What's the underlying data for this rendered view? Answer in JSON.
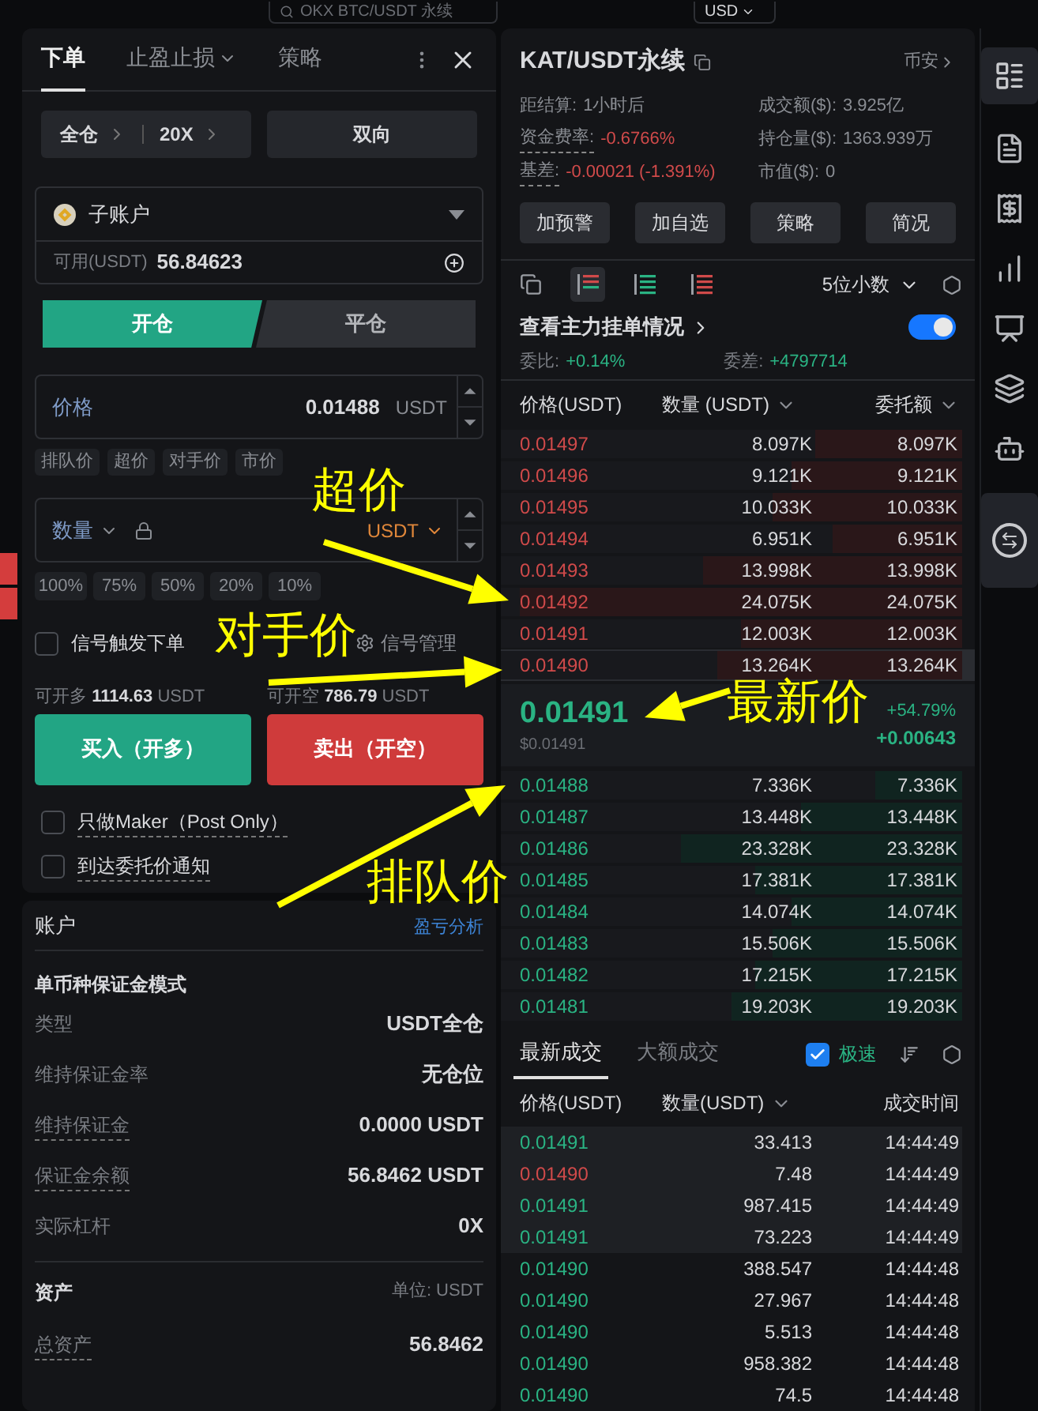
{
  "top_bar": {
    "search": "OKX BTC/USDT 永续",
    "currency": "USD"
  },
  "order_panel": {
    "tabs": [
      {
        "label": "下单",
        "selected": true,
        "dropdown": false
      },
      {
        "label": "止盈止损",
        "selected": false,
        "dropdown": true
      },
      {
        "label": "策略",
        "selected": false,
        "dropdown": false
      }
    ],
    "margin_mode": "全仓",
    "leverage": "20X",
    "position_mode": "双向",
    "account": {
      "name": "子账户",
      "available_label": "可用(USDT)",
      "available": "56.84623"
    },
    "sides": [
      {
        "label": "开仓",
        "selected": true
      },
      {
        "label": "平仓",
        "selected": false
      }
    ],
    "price": {
      "label": "价格",
      "value": "0.01488",
      "unit": "USDT"
    },
    "price_types": [
      "排队价",
      "超价",
      "对手价",
      "市价"
    ],
    "quantity": {
      "label": "数量",
      "unit": "USDT"
    },
    "percents": [
      "100%",
      "75%",
      "50%",
      "20%",
      "10%"
    ],
    "signal": {
      "label": "信号触发下单",
      "checked": false,
      "manage": "信号管理"
    },
    "max_long": {
      "label": "可开多",
      "value": "1114.63",
      "unit": "USDT"
    },
    "max_short": {
      "label": "可开空",
      "value": "786.79",
      "unit": "USDT"
    },
    "buy": "买入（开多）",
    "sell": "卖出（开空）",
    "options": [
      {
        "label": "只做Maker（Post Only）",
        "checked": false
      },
      {
        "label": "到达委托价通知",
        "checked": false
      }
    ]
  },
  "account_panel": {
    "title": "账户",
    "link": "盈亏分析",
    "mode": "单币种保证金模式",
    "rows": [
      {
        "label": "类型",
        "value": "USDT全仓",
        "dashed": false
      },
      {
        "label": "维持保证金率",
        "value": "无仓位",
        "dashed": false
      },
      {
        "label": "维持保证金",
        "value": "0.0000 USDT",
        "dashed": true
      },
      {
        "label": "保证金余额",
        "value": "56.8462 USDT",
        "dashed": true
      },
      {
        "label": "实际杠杆",
        "value": "0X",
        "dashed": false
      }
    ],
    "assets_title": "资产",
    "unit": "单位: USDT",
    "asset_rows": [
      {
        "label": "总资产",
        "value": "56.8462",
        "dashed": true
      }
    ]
  },
  "market": {
    "symbol": "KAT/USDT永续",
    "exchange": "币安",
    "stats": [
      {
        "label": "距结算:",
        "value": "1小时后",
        "kind": "plain",
        "dashed": false
      },
      {
        "label": "成交额($):",
        "value": "3.925亿",
        "kind": "plain",
        "dashed": false
      },
      {
        "label": "资金费率:",
        "value": "-0.6766%",
        "kind": "down",
        "dashed": true
      },
      {
        "label": "持仓量($):",
        "value": "1363.939万",
        "kind": "plain",
        "dashed": false
      },
      {
        "label": "基差:",
        "value": "-0.00021 (-1.391%)",
        "kind": "down",
        "dashed": true
      },
      {
        "label": "市值($):",
        "value": "0",
        "kind": "plain",
        "dashed": false
      }
    ],
    "buttons": [
      "加预警",
      "加自选",
      "策略",
      "简况"
    ]
  },
  "order_book": {
    "views": [
      {
        "kind": "add",
        "selected": false
      },
      {
        "kind": "both",
        "selected": true
      },
      {
        "kind": "bids",
        "selected": false
      },
      {
        "kind": "asks",
        "selected": false
      }
    ],
    "precision": "5位小数",
    "whale_label": "查看主力挂单情况",
    "whale_on": true,
    "ratio_label": "委比:",
    "ratio": "+0.14%",
    "diff_label": "委差:",
    "diff": "+4797714",
    "columns": [
      "价格(USDT)",
      "数量 (USDT)",
      "委托额"
    ],
    "asks": [
      {
        "price": "0.01497",
        "amount": "8.097K",
        "total": "8.097K",
        "level": 0.32,
        "selected": false
      },
      {
        "price": "0.01496",
        "amount": "9.121K",
        "total": "9.121K",
        "level": 0.37,
        "selected": false
      },
      {
        "price": "0.01495",
        "amount": "10.033K",
        "total": "10.033K",
        "level": 0.41,
        "selected": false
      },
      {
        "price": "0.01494",
        "amount": "6.951K",
        "total": "6.951K",
        "level": 0.28,
        "selected": false
      },
      {
        "price": "0.01493",
        "amount": "13.998K",
        "total": "13.998K",
        "level": 0.56,
        "selected": false
      },
      {
        "price": "0.01492",
        "amount": "24.075K",
        "total": "24.075K",
        "level": 0.96,
        "selected": false
      },
      {
        "price": "0.01491",
        "amount": "12.003K",
        "total": "12.003K",
        "level": 0.48,
        "selected": false
      },
      {
        "price": "0.01490",
        "amount": "13.264K",
        "total": "13.264K",
        "level": 0.53,
        "selected": true
      }
    ],
    "last_price": "0.01491",
    "last_price_usd": "$0.01491",
    "change_pct": "+54.79%",
    "change": "+0.00643",
    "bids": [
      {
        "price": "0.01488",
        "amount": "7.336K",
        "total": "7.336K",
        "level": 0.19,
        "selected": false
      },
      {
        "price": "0.01487",
        "amount": "13.448K",
        "total": "13.448K",
        "level": 0.35,
        "selected": false
      },
      {
        "price": "0.01486",
        "amount": "23.328K",
        "total": "23.328K",
        "level": 0.61,
        "selected": false
      },
      {
        "price": "0.01485",
        "amount": "17.381K",
        "total": "17.381K",
        "level": 0.45,
        "selected": false
      },
      {
        "price": "0.01484",
        "amount": "14.074K",
        "total": "14.074K",
        "level": 0.37,
        "selected": false
      },
      {
        "price": "0.01483",
        "amount": "15.506K",
        "total": "15.506K",
        "level": 0.41,
        "selected": false
      },
      {
        "price": "0.01482",
        "amount": "17.215K",
        "total": "17.215K",
        "level": 0.45,
        "selected": false
      },
      {
        "price": "0.01481",
        "amount": "19.203K",
        "total": "19.203K",
        "level": 0.5,
        "selected": false
      }
    ]
  },
  "trades": {
    "tabs": [
      {
        "label": "最新成交",
        "selected": true
      },
      {
        "label": "大额成交",
        "selected": false
      }
    ],
    "fast_label": "极速",
    "fast_checked": true,
    "columns": [
      "价格(USDT)",
      "数量(USDT)",
      "成交时间"
    ],
    "rows": [
      {
        "price": "0.01491",
        "amount": "33.413",
        "time": "14:44:49",
        "kind": "buy",
        "highlighted": true
      },
      {
        "price": "0.01490",
        "amount": "7.48",
        "time": "14:44:49",
        "kind": "sell",
        "highlighted": true
      },
      {
        "price": "0.01491",
        "amount": "987.415",
        "time": "14:44:49",
        "kind": "buy",
        "highlighted": true
      },
      {
        "price": "0.01491",
        "amount": "73.223",
        "time": "14:44:49",
        "kind": "buy",
        "highlighted": true
      },
      {
        "price": "0.01490",
        "amount": "388.547",
        "time": "14:44:48",
        "kind": "buy",
        "highlighted": false
      },
      {
        "price": "0.01490",
        "amount": "27.967",
        "time": "14:44:48",
        "kind": "buy",
        "highlighted": false
      },
      {
        "price": "0.01490",
        "amount": "5.513",
        "time": "14:44:48",
        "kind": "buy",
        "highlighted": false
      },
      {
        "price": "0.01490",
        "amount": "958.382",
        "time": "14:44:48",
        "kind": "buy",
        "highlighted": false
      },
      {
        "price": "0.01490",
        "amount": "74.5",
        "time": "14:44:48",
        "kind": "buy",
        "highlighted": false
      }
    ]
  },
  "annotations": [
    {
      "text": "超价"
    },
    {
      "text": "对手价"
    },
    {
      "text": "最新价"
    },
    {
      "text": "排队价"
    }
  ]
}
